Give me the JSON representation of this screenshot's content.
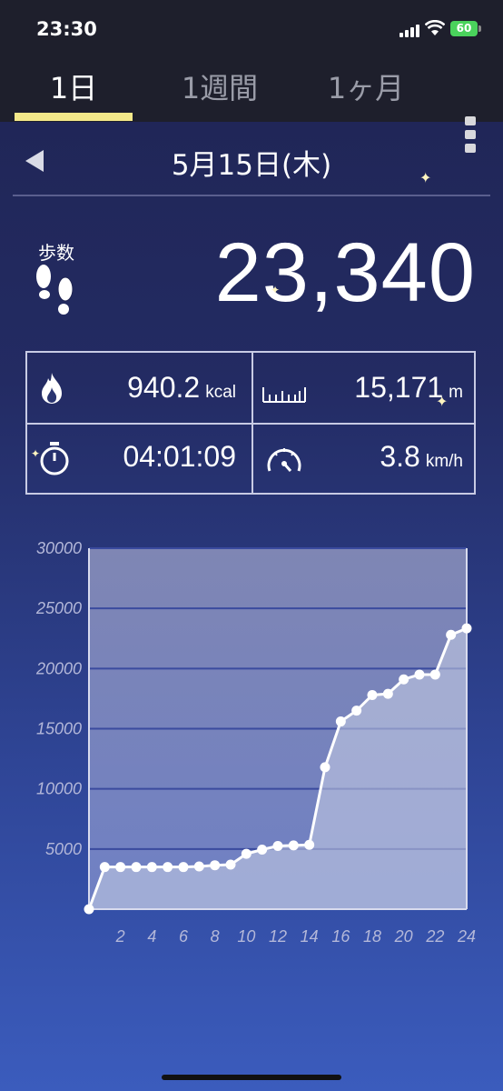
{
  "status_bar": {
    "time": "23:30",
    "battery": "60"
  },
  "tabs": [
    {
      "label": "1日",
      "active": true
    },
    {
      "label": "1週間",
      "active": false
    },
    {
      "label": "1ヶ月",
      "active": false
    }
  ],
  "date": "5月15日(木)",
  "steps": {
    "label": "歩数",
    "value": "23,340"
  },
  "stats": {
    "calories": {
      "value": "940.2",
      "unit": "kcal"
    },
    "distance": {
      "value": "15,171",
      "unit": "m"
    },
    "duration": {
      "value": "04:01:09"
    },
    "speed": {
      "value": "3.8",
      "unit": "km/h"
    }
  },
  "colors": {
    "accent_underline": "#f4e98a",
    "bg_top": "#1f2452",
    "bg_bottom": "#3b5cbd"
  },
  "icons": [
    "feet-icon",
    "flame-icon",
    "ruler-icon",
    "stopwatch-icon",
    "speedometer-icon",
    "back-arrow-icon",
    "menu-icon"
  ],
  "chart_data": {
    "type": "area",
    "title": "",
    "xlabel": "",
    "ylabel": "",
    "ylim": [
      0,
      30000
    ],
    "xlim": [
      0,
      24
    ],
    "y_ticks": [
      "30000",
      "25000",
      "20000",
      "15000",
      "10000",
      "5000"
    ],
    "x_ticks": [
      "2",
      "4",
      "6",
      "8",
      "10",
      "12",
      "14",
      "16",
      "18",
      "20",
      "22",
      "24"
    ],
    "grid": true,
    "x": [
      0,
      1,
      2,
      3,
      4,
      5,
      6,
      7,
      8,
      9,
      10,
      11,
      12,
      13,
      14,
      15,
      16,
      17,
      18,
      19,
      20,
      21,
      22,
      23,
      24
    ],
    "values": [
      0,
      3500,
      3500,
      3500,
      3500,
      3500,
      3500,
      3550,
      3650,
      3700,
      4600,
      4950,
      5250,
      5300,
      5350,
      11800,
      15600,
      16500,
      17800,
      17900,
      19100,
      19500,
      19500,
      22800,
      23340
    ]
  }
}
